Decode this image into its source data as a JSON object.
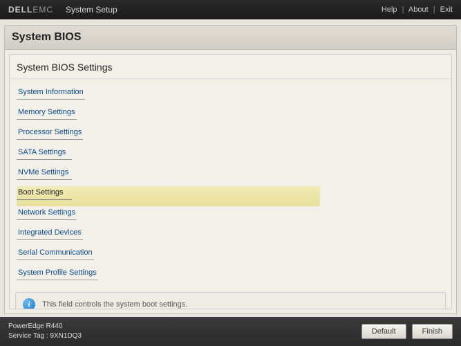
{
  "topbar": {
    "brand": "DELL",
    "brand_suffix": "EMC",
    "title": "System Setup",
    "links": {
      "help": "Help",
      "about": "About",
      "exit": "Exit"
    }
  },
  "page": {
    "title": "System BIOS",
    "subtitle": "System BIOS Settings"
  },
  "menu": {
    "items": [
      {
        "label": "System Information",
        "selected": false
      },
      {
        "label": "Memory Settings",
        "selected": false
      },
      {
        "label": "Processor Settings",
        "selected": false
      },
      {
        "label": "SATA Settings",
        "selected": false
      },
      {
        "label": "NVMe Settings",
        "selected": false
      },
      {
        "label": "Boot Settings",
        "selected": true
      },
      {
        "label": "Network Settings",
        "selected": false
      },
      {
        "label": "Integrated Devices",
        "selected": false
      },
      {
        "label": "Serial Communication",
        "selected": false
      },
      {
        "label": "System Profile Settings",
        "selected": false
      }
    ]
  },
  "help": {
    "text": "This field controls the system boot settings."
  },
  "footer": {
    "model": "PowerEdge R440",
    "service_tag_label": "Service Tag :",
    "service_tag": "9XN1DQ3",
    "buttons": {
      "default": "Default",
      "finish": "Finish"
    }
  }
}
